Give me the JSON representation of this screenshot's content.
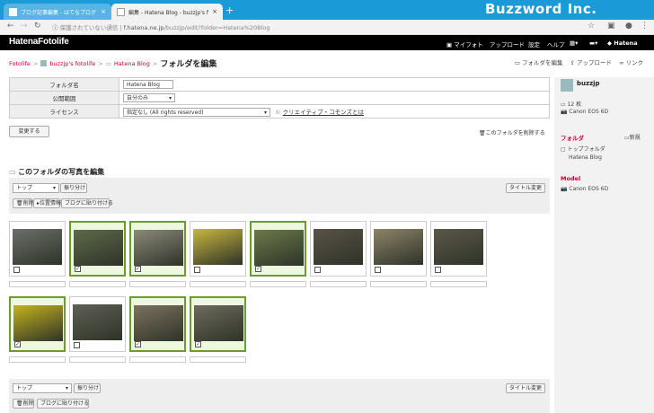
{
  "browser": {
    "tabs": [
      {
        "label": "ブログ記事編集 - はてなブログ"
      },
      {
        "label": "編集 - Hatena Blog - buzzjp's fot"
      }
    ],
    "brand": "Buzzword Inc.",
    "security_label": "保護されていない通信",
    "url_host": "f.hatena.ne.jp",
    "url_path": "/buzzjp/edit?folder=Hatena%20Blog"
  },
  "header": {
    "logo": "HatenaFotolife",
    "menu": [
      "マイフォト",
      "アップロード",
      "設定",
      "ヘルプ"
    ],
    "hatena": "Hatena"
  },
  "breadcrumb": {
    "root": "Fotolife",
    "user": "buzzjp's fotolife",
    "folder": "Hatena Blog",
    "current": "フォルダを編集"
  },
  "actions": {
    "edit_folder": "フォルダを編集",
    "upload": "アップロード",
    "link": "リンク"
  },
  "form": {
    "name_label": "フォルダ名",
    "name_value": "Hatena Blog",
    "scope_label": "公開範囲",
    "scope_value": "自分のみ",
    "license_label": "ライセンス",
    "license_value": "指定なし (All rights reserved)",
    "cc_link": "クリエイティブ・コモンズとは",
    "change_button": "変更する",
    "delete_folder": "このフォルダを削除する"
  },
  "photos": {
    "title": "このフォルダの写真を編集",
    "folder_select": "トップ",
    "move_button": "振り分け",
    "title_change_button": "タイトル変更",
    "delete_button": "削除",
    "location_button": "位置情報",
    "blog_paste_button": "ブログに貼り付ける",
    "items": [
      {
        "selected": false,
        "color": "#6b6f6a"
      },
      {
        "selected": true,
        "color": "#5d6a4a"
      },
      {
        "selected": true,
        "color": "#8a8a7a"
      },
      {
        "selected": false,
        "color": "#c9b740"
      },
      {
        "selected": true,
        "color": "#6b7a4a"
      },
      {
        "selected": false,
        "color": "#5a5248"
      },
      {
        "selected": false,
        "color": "#8d8468"
      },
      {
        "selected": false,
        "color": "#5d584a"
      },
      {
        "selected": true,
        "color": "#c4b31f"
      },
      {
        "selected": false,
        "color": "#5f6056"
      },
      {
        "selected": true,
        "color": "#7d7260"
      },
      {
        "selected": true,
        "color": "#6e6a5e"
      }
    ]
  },
  "sidebar": {
    "user": "buzzjp",
    "count": "12 枚",
    "camera": "Canon EOS 6D",
    "folder_head": "フォルダ",
    "new_label": "新規",
    "top_folder": "トップフォルダ",
    "blog_folder": "Hatena Blog",
    "model_head": "Model",
    "model_camera": "Canon EOS 6D"
  }
}
